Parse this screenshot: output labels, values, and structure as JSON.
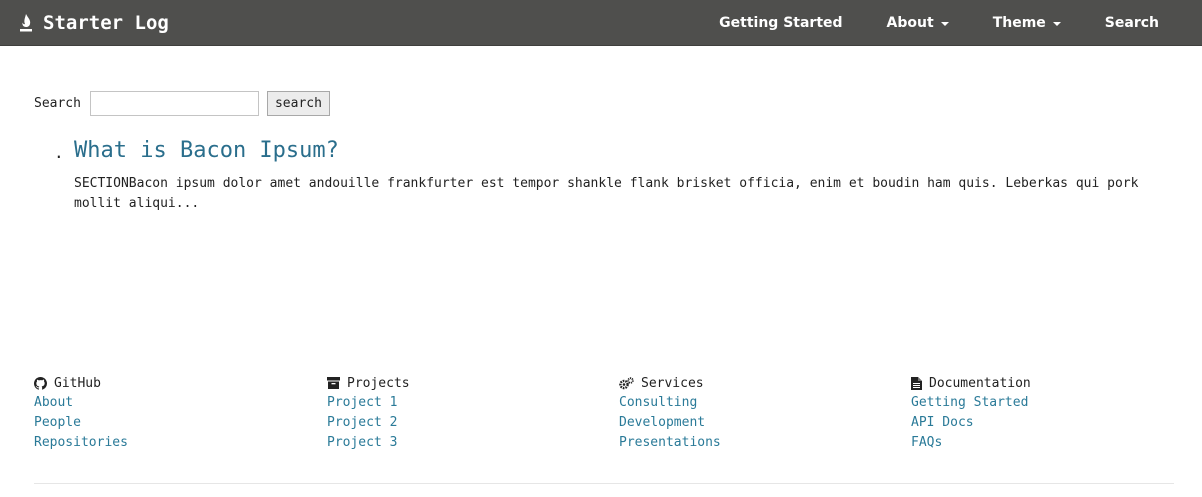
{
  "navbar": {
    "brand_icon": "flame-icon",
    "brand": "Starter Log",
    "items": [
      {
        "label": "Getting Started",
        "has_caret": false
      },
      {
        "label": "About",
        "has_caret": true
      },
      {
        "label": "Theme",
        "has_caret": true
      },
      {
        "label": "Search",
        "has_caret": false
      }
    ]
  },
  "search": {
    "label": "Search",
    "value": "",
    "button_label": "search"
  },
  "results": [
    {
      "bullet": ".",
      "title": "What is Bacon Ipsum?",
      "excerpt": "SECTIONBacon ipsum dolor amet andouille frankfurter est tempor shankle flank brisket officia, enim et boudin ham quis. Leberkas qui pork mollit aliqui..."
    }
  ],
  "footer": {
    "columns": [
      {
        "heading": "GitHub",
        "icon": "github-icon",
        "links": [
          "About",
          "People",
          "Repositories"
        ]
      },
      {
        "heading": "Projects",
        "icon": "archive-icon",
        "links": [
          "Project 1",
          "Project 2",
          "Project 3"
        ]
      },
      {
        "heading": "Services",
        "icon": "gears-icon",
        "links": [
          "Consulting",
          "Development",
          "Presentations"
        ]
      },
      {
        "heading": "Documentation",
        "icon": "document-icon",
        "links": [
          "Getting Started",
          "API Docs",
          "FAQs"
        ]
      }
    ]
  },
  "colors": {
    "navbar_bg": "#4f4f4d",
    "link": "#2a7a98",
    "title_link": "#2a6e8c"
  }
}
